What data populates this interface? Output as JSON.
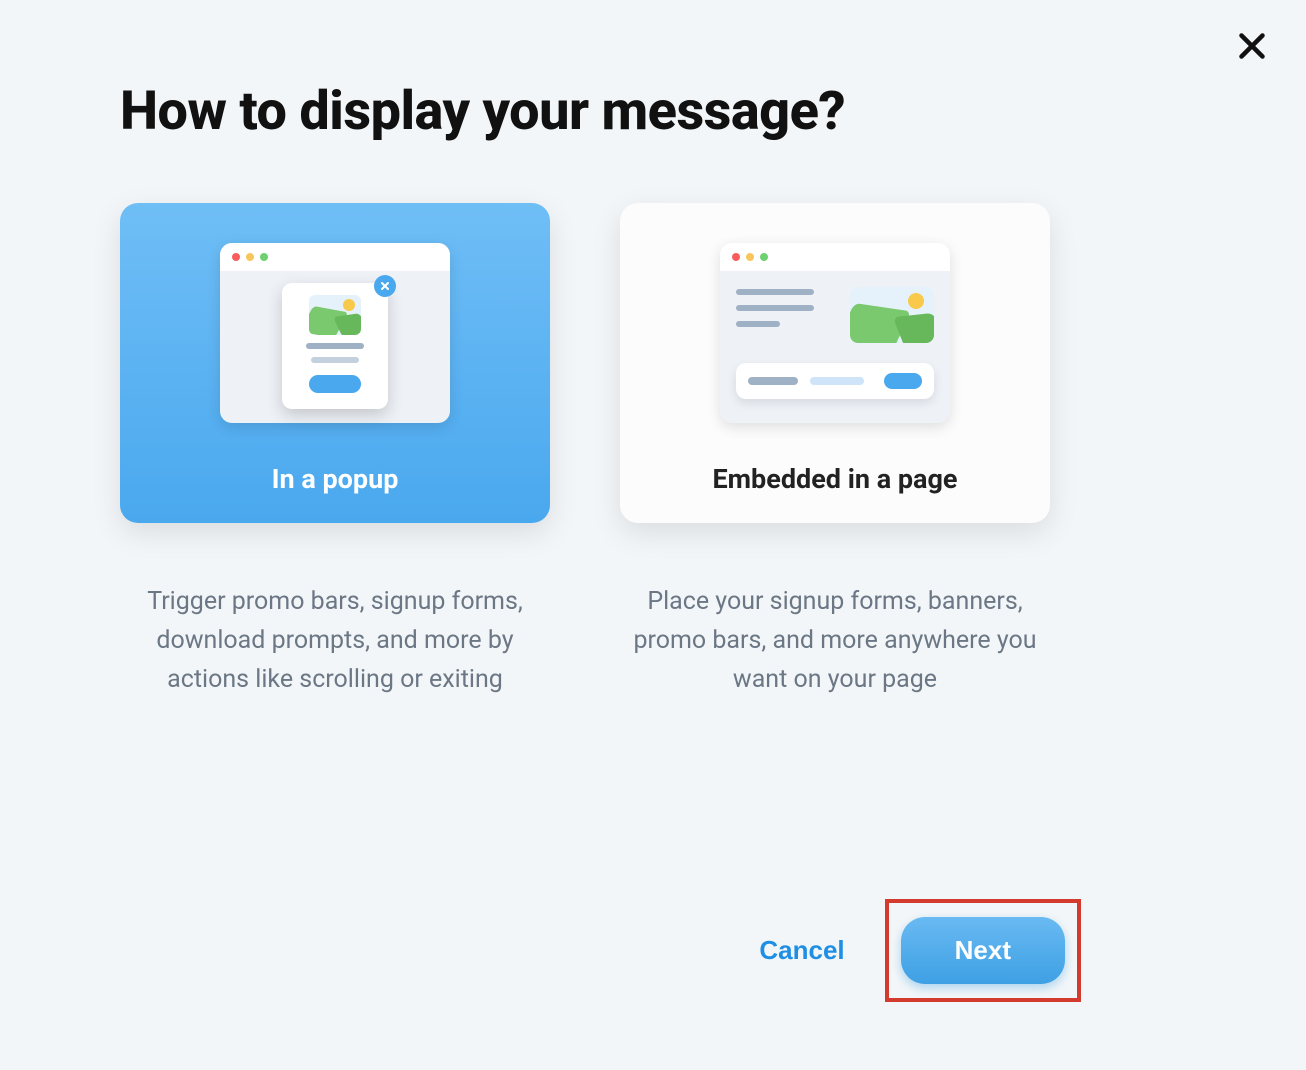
{
  "title": "How to display your message?",
  "options": [
    {
      "label": "In a popup",
      "selected": true,
      "description": "Trigger promo bars, signup forms, download prompts, and more by actions like scrolling or exiting"
    },
    {
      "label": "Embedded in a page",
      "selected": false,
      "description": "Place your signup forms, banners, promo bars, and more anywhere you want on your page"
    }
  ],
  "buttons": {
    "cancel": "Cancel",
    "next": "Next"
  },
  "highlight": "next"
}
